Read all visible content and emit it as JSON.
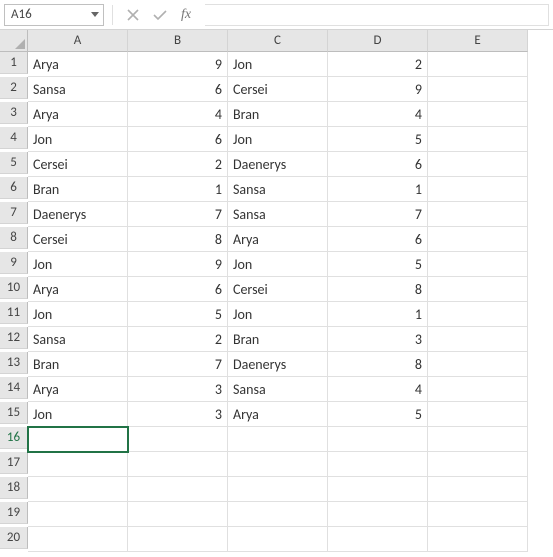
{
  "name_box": {
    "value": "A16"
  },
  "formula_bar": {
    "fx_label": "fx",
    "input_value": ""
  },
  "columns": [
    "A",
    "B",
    "C",
    "D",
    "E"
  ],
  "row_numbers": [
    1,
    2,
    3,
    4,
    5,
    6,
    7,
    8,
    9,
    10,
    11,
    12,
    13,
    14,
    15,
    16,
    17,
    18,
    19,
    20
  ],
  "active_cell": "A16",
  "chart_data": {
    "type": "table",
    "columns": [
      "A",
      "B",
      "C",
      "D"
    ],
    "rows": [
      {
        "A": "Arya",
        "B": 9,
        "C": "Jon",
        "D": 2
      },
      {
        "A": "Sansa",
        "B": 6,
        "C": "Cersei",
        "D": 9
      },
      {
        "A": "Arya",
        "B": 4,
        "C": "Bran",
        "D": 4
      },
      {
        "A": "Jon",
        "B": 6,
        "C": "Jon",
        "D": 5
      },
      {
        "A": "Cersei",
        "B": 2,
        "C": "Daenerys",
        "D": 6
      },
      {
        "A": "Bran",
        "B": 1,
        "C": "Sansa",
        "D": 1
      },
      {
        "A": "Daenerys",
        "B": 7,
        "C": "Sansa",
        "D": 7
      },
      {
        "A": "Cersei",
        "B": 8,
        "C": "Arya",
        "D": 6
      },
      {
        "A": "Jon",
        "B": 9,
        "C": "Jon",
        "D": 5
      },
      {
        "A": "Arya",
        "B": 6,
        "C": "Cersei",
        "D": 8
      },
      {
        "A": "Jon",
        "B": 5,
        "C": "Jon",
        "D": 1
      },
      {
        "A": "Sansa",
        "B": 2,
        "C": "Bran",
        "D": 3
      },
      {
        "A": "Bran",
        "B": 7,
        "C": "Daenerys",
        "D": 8
      },
      {
        "A": "Arya",
        "B": 3,
        "C": "Sansa",
        "D": 4
      },
      {
        "A": "Jon",
        "B": 3,
        "C": "Arya",
        "D": 5
      }
    ]
  }
}
